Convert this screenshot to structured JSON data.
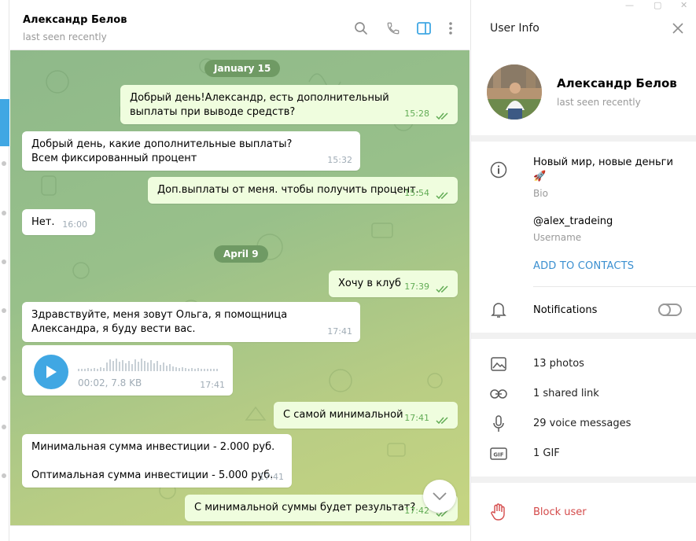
{
  "colors": {
    "accent": "#40a7e3",
    "outgoing_bubble": "#effdde",
    "incoming_bubble": "#ffffff",
    "date_pill": "#6f9a64",
    "danger": "#d44a4a",
    "link": "#3a8fd0"
  },
  "chat": {
    "name": "Александр Белов",
    "status": "last seen recently",
    "icons": [
      "search-icon",
      "phone-icon",
      "sidebar-toggle-icon",
      "more-vert-icon"
    ]
  },
  "messages": [
    {
      "kind": "date",
      "text": "January 15"
    },
    {
      "kind": "out",
      "text": "Добрый день!Александр, есть дополнительный выплаты при выводе средств?",
      "time": "15:28"
    },
    {
      "kind": "in",
      "text": "Добрый день, какие дополнительные выплаты? Всем фиксированный процент",
      "time": "15:32"
    },
    {
      "kind": "out",
      "text": "Доп.выплаты от меня. чтобы получить процент.",
      "time": "15:54"
    },
    {
      "kind": "in",
      "text": "Нет.",
      "time": "16:00"
    },
    {
      "kind": "date",
      "text": "April 9"
    },
    {
      "kind": "out",
      "text": "Хочу в клуб",
      "time": "17:39"
    },
    {
      "kind": "in",
      "text": "Здравствуйте, меня зовут Ольга, я помощница Александра, я буду вести вас.",
      "time": "17:41"
    },
    {
      "kind": "voice",
      "meta": "00:02, 7.8 KB",
      "time": "17:41"
    },
    {
      "kind": "out",
      "text": "С самой минимальной",
      "time": "17:41"
    },
    {
      "kind": "in",
      "text_line1": "Минимальная сумма инвестиции - 2.000 руб.",
      "text_line2": "Оптимальная сумма инвестиции - 5.000 руб.",
      "time": "17:41"
    },
    {
      "kind": "out",
      "text": "С минимальной суммы будет результат?",
      "time": "17:42"
    }
  ],
  "panel": {
    "title": "User Info",
    "name": "Александр Белов",
    "status": "last seen recently",
    "bio": "Новый мир, новые деньги 🚀",
    "bio_label": "Bio",
    "username": "@alex_tradeing",
    "username_label": "Username",
    "add_contacts": "ADD TO CONTACTS",
    "notifications": "Notifications",
    "notifications_on": false,
    "media": [
      {
        "icon": "photo-icon",
        "label": "13 photos"
      },
      {
        "icon": "link-icon",
        "label": "1 shared link"
      },
      {
        "icon": "microphone-icon",
        "label": "29 voice messages"
      },
      {
        "icon": "gif-icon",
        "label": "1 GIF"
      }
    ],
    "block": "Block user"
  }
}
